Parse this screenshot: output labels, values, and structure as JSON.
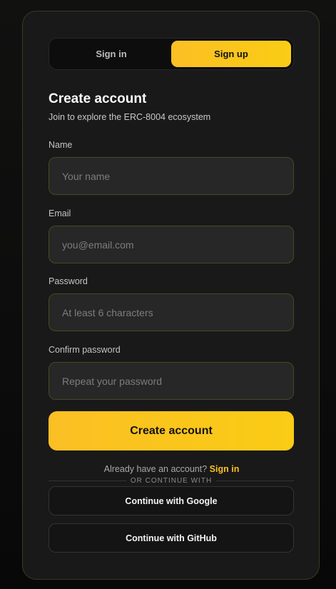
{
  "tabs": [
    {
      "label": "Sign in",
      "active": false
    },
    {
      "label": "Sign up",
      "active": true
    }
  ],
  "header": {
    "title": "Create account",
    "subtitle": "Join to explore the ERC-8004 ecosystem"
  },
  "form": {
    "name": {
      "label": "Name",
      "placeholder": "Your name",
      "value": ""
    },
    "email": {
      "label": "Email",
      "placeholder": "you@email.com",
      "value": ""
    },
    "password": {
      "label": "Password",
      "placeholder": "At least 6 characters",
      "value": ""
    },
    "confirm": {
      "label": "Confirm password",
      "placeholder": "Repeat your password",
      "value": ""
    },
    "submit_label": "Create account"
  },
  "footer": {
    "have_account": "Already have an account?",
    "sign_in_link": "Sign in",
    "divider": "OR CONTINUE WITH",
    "google": "Continue with Google",
    "github": "Continue with GitHub"
  },
  "colors": {
    "accent": "#fbbf24",
    "card_bg": "#191919",
    "card_border": "#3d3a1e"
  }
}
